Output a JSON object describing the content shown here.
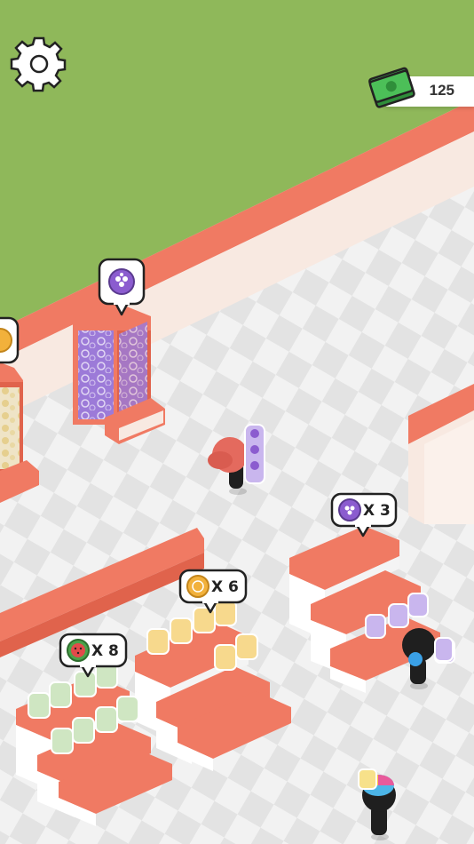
{
  "hud": {
    "settings_icon": "gear-icon",
    "money_icon": "cash-stack-icon",
    "money_amount": "125"
  },
  "bubbles": {
    "grape_vending": {
      "icon": "grape-coin-icon"
    },
    "orange_vending": {
      "icon": "orange-coin-icon"
    },
    "grape_shelf": {
      "icon": "grape-coin-icon",
      "count": "X 3"
    },
    "orange_shelf": {
      "icon": "orange-coin-icon",
      "count": "X 6"
    },
    "melon_shelf": {
      "icon": "watermelon-coin-icon",
      "count": "X 8"
    }
  },
  "colors": {
    "grass": "#8fb85a",
    "wall": "#f07a63",
    "floor_light": "#f1f1f1",
    "floor_dark": "#e4e4e4",
    "grape": "#8b5ccf",
    "orange": "#f2b13b",
    "melon": "#e24a4a"
  }
}
